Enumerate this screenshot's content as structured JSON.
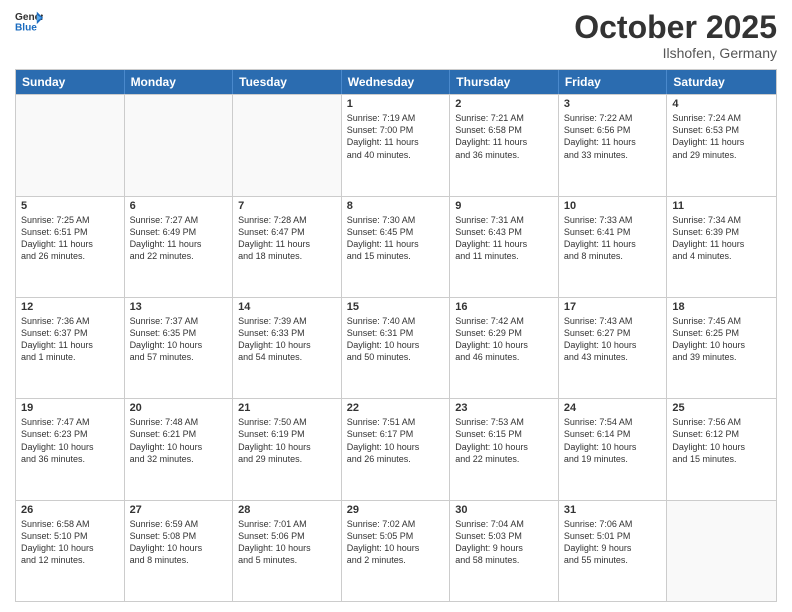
{
  "logo": {
    "general": "General",
    "blue": "Blue"
  },
  "header": {
    "month": "October 2025",
    "location": "Ilshofen, Germany"
  },
  "weekdays": [
    "Sunday",
    "Monday",
    "Tuesday",
    "Wednesday",
    "Thursday",
    "Friday",
    "Saturday"
  ],
  "rows": [
    [
      {
        "day": "",
        "text": ""
      },
      {
        "day": "",
        "text": ""
      },
      {
        "day": "",
        "text": ""
      },
      {
        "day": "1",
        "text": "Sunrise: 7:19 AM\nSunset: 7:00 PM\nDaylight: 11 hours\nand 40 minutes."
      },
      {
        "day": "2",
        "text": "Sunrise: 7:21 AM\nSunset: 6:58 PM\nDaylight: 11 hours\nand 36 minutes."
      },
      {
        "day": "3",
        "text": "Sunrise: 7:22 AM\nSunset: 6:56 PM\nDaylight: 11 hours\nand 33 minutes."
      },
      {
        "day": "4",
        "text": "Sunrise: 7:24 AM\nSunset: 6:53 PM\nDaylight: 11 hours\nand 29 minutes."
      }
    ],
    [
      {
        "day": "5",
        "text": "Sunrise: 7:25 AM\nSunset: 6:51 PM\nDaylight: 11 hours\nand 26 minutes."
      },
      {
        "day": "6",
        "text": "Sunrise: 7:27 AM\nSunset: 6:49 PM\nDaylight: 11 hours\nand 22 minutes."
      },
      {
        "day": "7",
        "text": "Sunrise: 7:28 AM\nSunset: 6:47 PM\nDaylight: 11 hours\nand 18 minutes."
      },
      {
        "day": "8",
        "text": "Sunrise: 7:30 AM\nSunset: 6:45 PM\nDaylight: 11 hours\nand 15 minutes."
      },
      {
        "day": "9",
        "text": "Sunrise: 7:31 AM\nSunset: 6:43 PM\nDaylight: 11 hours\nand 11 minutes."
      },
      {
        "day": "10",
        "text": "Sunrise: 7:33 AM\nSunset: 6:41 PM\nDaylight: 11 hours\nand 8 minutes."
      },
      {
        "day": "11",
        "text": "Sunrise: 7:34 AM\nSunset: 6:39 PM\nDaylight: 11 hours\nand 4 minutes."
      }
    ],
    [
      {
        "day": "12",
        "text": "Sunrise: 7:36 AM\nSunset: 6:37 PM\nDaylight: 11 hours\nand 1 minute."
      },
      {
        "day": "13",
        "text": "Sunrise: 7:37 AM\nSunset: 6:35 PM\nDaylight: 10 hours\nand 57 minutes."
      },
      {
        "day": "14",
        "text": "Sunrise: 7:39 AM\nSunset: 6:33 PM\nDaylight: 10 hours\nand 54 minutes."
      },
      {
        "day": "15",
        "text": "Sunrise: 7:40 AM\nSunset: 6:31 PM\nDaylight: 10 hours\nand 50 minutes."
      },
      {
        "day": "16",
        "text": "Sunrise: 7:42 AM\nSunset: 6:29 PM\nDaylight: 10 hours\nand 46 minutes."
      },
      {
        "day": "17",
        "text": "Sunrise: 7:43 AM\nSunset: 6:27 PM\nDaylight: 10 hours\nand 43 minutes."
      },
      {
        "day": "18",
        "text": "Sunrise: 7:45 AM\nSunset: 6:25 PM\nDaylight: 10 hours\nand 39 minutes."
      }
    ],
    [
      {
        "day": "19",
        "text": "Sunrise: 7:47 AM\nSunset: 6:23 PM\nDaylight: 10 hours\nand 36 minutes."
      },
      {
        "day": "20",
        "text": "Sunrise: 7:48 AM\nSunset: 6:21 PM\nDaylight: 10 hours\nand 32 minutes."
      },
      {
        "day": "21",
        "text": "Sunrise: 7:50 AM\nSunset: 6:19 PM\nDaylight: 10 hours\nand 29 minutes."
      },
      {
        "day": "22",
        "text": "Sunrise: 7:51 AM\nSunset: 6:17 PM\nDaylight: 10 hours\nand 26 minutes."
      },
      {
        "day": "23",
        "text": "Sunrise: 7:53 AM\nSunset: 6:15 PM\nDaylight: 10 hours\nand 22 minutes."
      },
      {
        "day": "24",
        "text": "Sunrise: 7:54 AM\nSunset: 6:14 PM\nDaylight: 10 hours\nand 19 minutes."
      },
      {
        "day": "25",
        "text": "Sunrise: 7:56 AM\nSunset: 6:12 PM\nDaylight: 10 hours\nand 15 minutes."
      }
    ],
    [
      {
        "day": "26",
        "text": "Sunrise: 6:58 AM\nSunset: 5:10 PM\nDaylight: 10 hours\nand 12 minutes."
      },
      {
        "day": "27",
        "text": "Sunrise: 6:59 AM\nSunset: 5:08 PM\nDaylight: 10 hours\nand 8 minutes."
      },
      {
        "day": "28",
        "text": "Sunrise: 7:01 AM\nSunset: 5:06 PM\nDaylight: 10 hours\nand 5 minutes."
      },
      {
        "day": "29",
        "text": "Sunrise: 7:02 AM\nSunset: 5:05 PM\nDaylight: 10 hours\nand 2 minutes."
      },
      {
        "day": "30",
        "text": "Sunrise: 7:04 AM\nSunset: 5:03 PM\nDaylight: 9 hours\nand 58 minutes."
      },
      {
        "day": "31",
        "text": "Sunrise: 7:06 AM\nSunset: 5:01 PM\nDaylight: 9 hours\nand 55 minutes."
      },
      {
        "day": "",
        "text": ""
      }
    ]
  ]
}
